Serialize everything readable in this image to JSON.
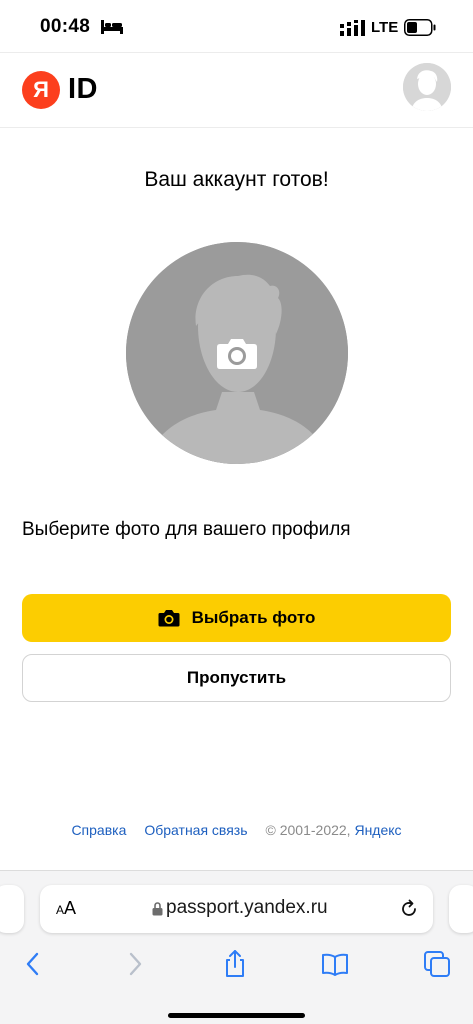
{
  "status_bar": {
    "time": "00:48",
    "network": "LTE"
  },
  "header": {
    "logo_letter": "Я",
    "id_label": "ID"
  },
  "main": {
    "title": "Ваш аккаунт готов!",
    "prompt": "Выберите фото для вашего профиля",
    "choose_photo_label": "Выбрать фото",
    "skip_label": "Пропустить"
  },
  "footer": {
    "help_link": "Справка",
    "feedback_link": "Обратная связь",
    "copyright": "© 2001-2022,",
    "brand_link": "Яндекс"
  },
  "browser": {
    "text_size_label_small": "A",
    "text_size_label_big": "A",
    "url": "passport.yandex.ru"
  },
  "icons": [
    "bed-icon",
    "signal-icon",
    "battery-icon",
    "camera-icon",
    "lock-icon",
    "reload-icon",
    "back-icon",
    "forward-icon",
    "share-icon",
    "bookmarks-icon",
    "tabs-icon"
  ],
  "colors": {
    "accent_yellow": "#fccd01",
    "logo_red": "#fc3f1d",
    "link_blue": "#1d5fbf",
    "ios_blue": "#2f7df6"
  }
}
